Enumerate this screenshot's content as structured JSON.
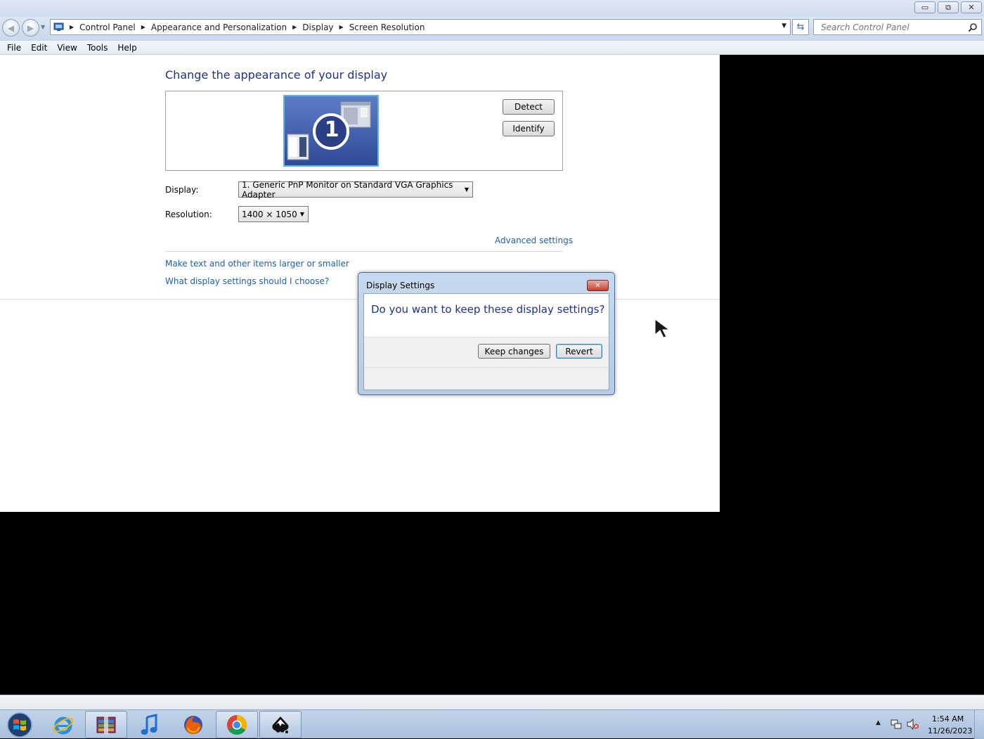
{
  "window": {
    "caption_buttons": {
      "minimize": "▭",
      "restore": "⧉",
      "close": "✕"
    }
  },
  "address": {
    "crumbs": [
      "Control Panel",
      "Appearance and Personalization",
      "Display",
      "Screen Resolution"
    ],
    "search_placeholder": "Search Control Panel"
  },
  "menu": [
    "File",
    "Edit",
    "View",
    "Tools",
    "Help"
  ],
  "page": {
    "title": "Change the appearance of your display",
    "monitor_number": "1",
    "detect_label": "Detect",
    "identify_label": "Identify",
    "display_label": "Display:",
    "display_value": "1. Generic PnP Monitor on Standard VGA Graphics Adapter",
    "resolution_label": "Resolution:",
    "resolution_value": "1400 × 1050",
    "advanced_link": "Advanced settings",
    "link_text_size": "Make text and other items larger or smaller",
    "link_which_settings": "What display settings should I choose?"
  },
  "dialog": {
    "title": "Display Settings",
    "question": "Do you want to keep these display settings?",
    "keep_label": "Keep changes",
    "revert_label": "Revert"
  },
  "taskbar": {
    "apps": [
      "internet-explorer",
      "winrar",
      "itunes",
      "firefox",
      "chrome",
      "inkscape"
    ],
    "clock_time": "1:54 AM",
    "clock_date": "11/26/2023"
  },
  "colors": {
    "title_text": "#1e3287",
    "link": "#1e5fa8",
    "monitor_fill": "#3d59a8"
  }
}
